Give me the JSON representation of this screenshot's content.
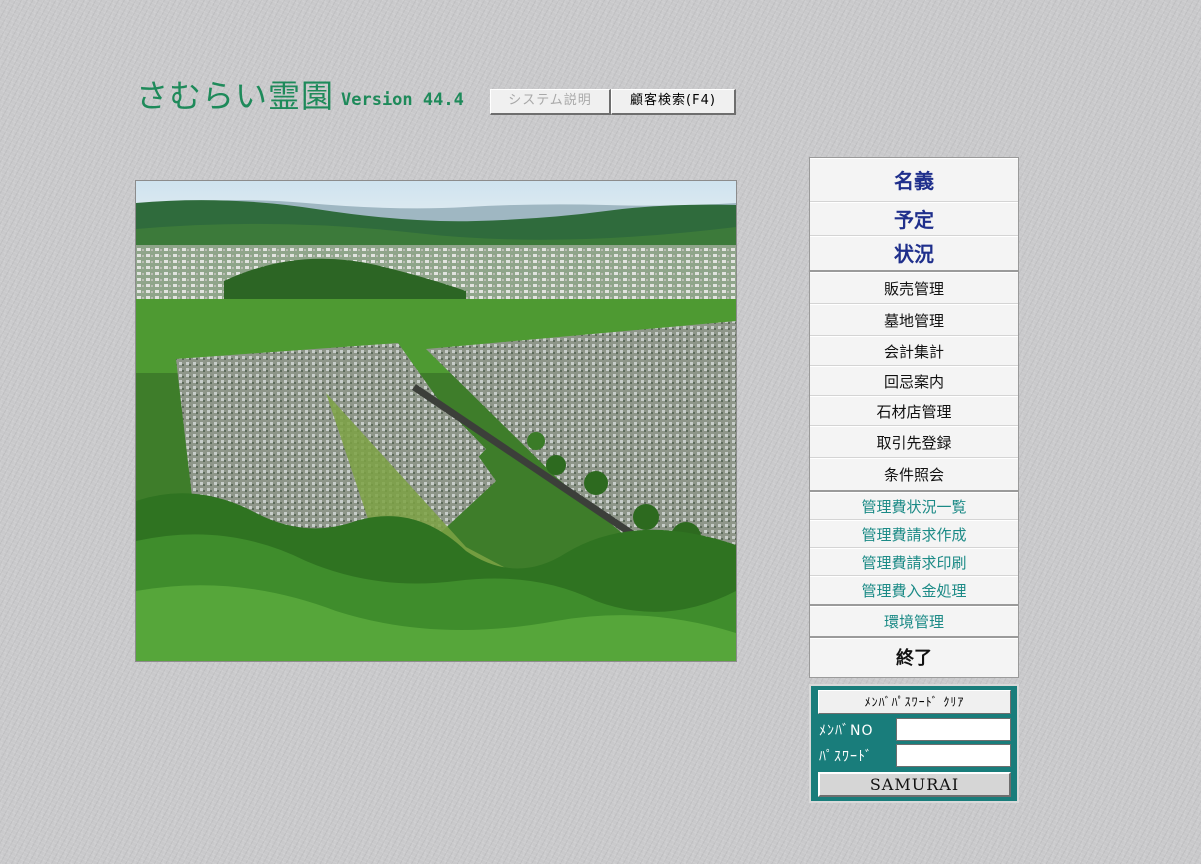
{
  "header": {
    "app_title": "さむらい霊園",
    "version": "Version 44.4",
    "buttons": [
      {
        "label": "システム説明",
        "enabled": false
      },
      {
        "label": "顧客検索(F4)",
        "enabled": true
      }
    ]
  },
  "menu": {
    "items": [
      {
        "label": "名義"
      },
      {
        "label": "予定"
      },
      {
        "label": "状況"
      },
      {
        "label": "販売管理"
      },
      {
        "label": "墓地管理"
      },
      {
        "label": "会計集計"
      },
      {
        "label": "回忌案内"
      },
      {
        "label": "石材店管理"
      },
      {
        "label": "取引先登録"
      },
      {
        "label": "条件照会"
      },
      {
        "label": "管理費状況一覧"
      },
      {
        "label": "管理費請求作成"
      },
      {
        "label": "管理費請求印刷"
      },
      {
        "label": "管理費入金処理"
      },
      {
        "label": "環境管理"
      },
      {
        "label": "終了"
      }
    ]
  },
  "login": {
    "clear_label": "ﾒﾝﾊﾞﾊﾟｽﾜｰﾄﾞ ｸﾘｱ",
    "member_no_label": "ﾒﾝﾊﾞNO",
    "password_label": "ﾊﾟｽﾜｰﾄﾞ",
    "member_no_value": "",
    "password_value": "",
    "submit_label": "SAMURAI"
  },
  "colors": {
    "title_green": "#1e8a5a",
    "menu_blue": "#1f2f8c",
    "menu_teal": "#1b8a86",
    "login_bg": "#197d7b"
  }
}
